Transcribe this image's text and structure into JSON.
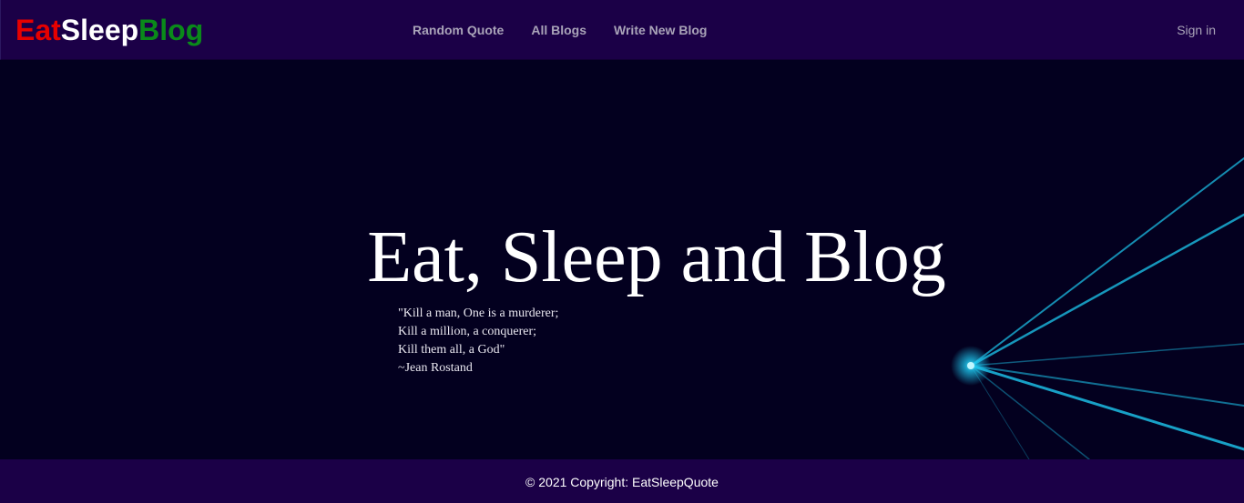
{
  "navbar": {
    "brand": {
      "part1": "Eat",
      "part2": "Sleep",
      "part3": "Blog",
      "colors": [
        "#e60000",
        "#ffffff",
        "#0a8a1a"
      ]
    },
    "links": [
      "Random Quote",
      "All Blogs",
      "Write New Blog"
    ],
    "signin": "Sign in"
  },
  "hero": {
    "title": "Eat, Sleep and Blog",
    "quote_lines": [
      "\"Kill a man, One is a murderer;",
      "Kill a million, a conquerer;",
      "Kill them all, a God\"",
      "~Jean Rostand"
    ]
  },
  "footer": {
    "copyright": "© 2021 Copyright: EatSleepQuote"
  },
  "colors": {
    "navbar_bg": "#1b0047",
    "hero_bg": "#03001f",
    "ray_color": "#1ec8f0"
  }
}
